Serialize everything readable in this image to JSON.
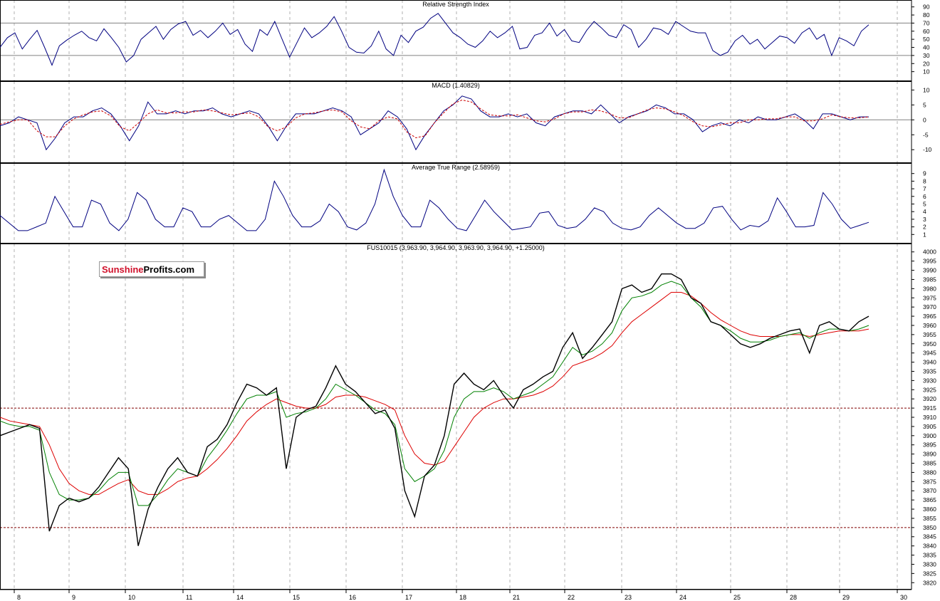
{
  "logo": {
    "part1": "Sunshine",
    "part2": "Profits.com"
  },
  "colors": {
    "rsi": "#000080",
    "macd": "#000080",
    "macd_signal": "#cc0000",
    "atr": "#000080",
    "price": "#000000",
    "ma_fast": "#008000",
    "ma_slow": "#dd0000",
    "guide": "#800000"
  },
  "chart_data": [
    {
      "type": "line",
      "title": "Relative Strength Index",
      "ylim": [
        0,
        95
      ],
      "yticks": [
        10,
        20,
        30,
        40,
        50,
        60,
        70,
        80,
        90
      ],
      "reference_lines": [
        30,
        70
      ],
      "series": [
        {
          "values": [
            40,
            52,
            58,
            38,
            50,
            61,
            40,
            18,
            42,
            49,
            55,
            60,
            52,
            48,
            63,
            52,
            40,
            22,
            30,
            50,
            58,
            66,
            50,
            62,
            69,
            72,
            55,
            61,
            52,
            60,
            70,
            56,
            62,
            44,
            35,
            62,
            55,
            72,
            50,
            28,
            46,
            64,
            52,
            58,
            66,
            78,
            60,
            40,
            34,
            33,
            42,
            60,
            38,
            30,
            55,
            46,
            60,
            65,
            76,
            82,
            70,
            58,
            52,
            44,
            40,
            48,
            60,
            52,
            58,
            66,
            38,
            40,
            55,
            58,
            70,
            54,
            62,
            48,
            46,
            61,
            72,
            64,
            55,
            52,
            68,
            62,
            40,
            50,
            64,
            62,
            56,
            72,
            66,
            60,
            58,
            58,
            36,
            30,
            34,
            48,
            55,
            44,
            50,
            38,
            46,
            54,
            52,
            45,
            58,
            64,
            50,
            56,
            30,
            52,
            48,
            42,
            60,
            68
          ]
        }
      ]
    },
    {
      "type": "line",
      "title": "MACD (1.40829)",
      "ylim": [
        -14,
        12
      ],
      "yticks": [
        10,
        5,
        0,
        -5,
        -10
      ],
      "reference_lines": [
        0
      ],
      "series": [
        {
          "values": [
            -2,
            -1,
            1,
            0,
            -1,
            -10,
            -6,
            -1,
            1,
            1,
            3,
            4,
            2,
            -2,
            -7,
            -2,
            6,
            2,
            2,
            3,
            2,
            3,
            3,
            4,
            2,
            1,
            2,
            3,
            2,
            -2,
            -7,
            -2,
            2,
            2,
            2,
            3,
            4,
            3,
            1,
            -5,
            -3,
            -1,
            3,
            1,
            -3,
            -10,
            -5,
            -1,
            3,
            5,
            8,
            7,
            3,
            1,
            1,
            2,
            1,
            2,
            -1,
            -2,
            1,
            2,
            3,
            3,
            2,
            5,
            2,
            -1,
            1,
            2,
            3,
            5,
            4,
            2,
            2,
            0,
            -4,
            -2,
            -1,
            -2,
            0,
            -1,
            1,
            0,
            0,
            1,
            2,
            0,
            -3,
            2,
            2,
            1,
            0,
            1,
            1
          ]
        }
      ]
    },
    {
      "type": "line",
      "title": "Average True Range (2.58959)",
      "ylim": [
        0,
        10
      ],
      "yticks": [
        1,
        2,
        3,
        4,
        5,
        6,
        7,
        8,
        9
      ],
      "series": [
        {
          "values": [
            3.5,
            2.5,
            1.5,
            1.5,
            2,
            2.5,
            6,
            4,
            2,
            2,
            5.5,
            5,
            2.5,
            1.5,
            3,
            6.5,
            5.5,
            3,
            2,
            2,
            4.5,
            4,
            2,
            2,
            3,
            3.5,
            2.5,
            1.5,
            1.5,
            3,
            8,
            6,
            3.5,
            2,
            2,
            2.8,
            5,
            4,
            2,
            1.6,
            2.5,
            5,
            9.5,
            6,
            3.5,
            2,
            2,
            5.5,
            4.5,
            3,
            1.8,
            1.5,
            3.5,
            5.5,
            4,
            2.8,
            1.6,
            1.8,
            2,
            3.8,
            4,
            2.2,
            1.8,
            2,
            3,
            4.5,
            4,
            2.5,
            1.8,
            1.6,
            2,
            3.5,
            4.5,
            3.5,
            2.5,
            1.8,
            1.8,
            2.5,
            4.5,
            4.7,
            3,
            1.6,
            2.2,
            2,
            2.8,
            5.8,
            4,
            2,
            2,
            2.2,
            6.5,
            5,
            3,
            1.8,
            2.2,
            2.6
          ]
        }
      ]
    },
    {
      "type": "line",
      "title": "FUS10015 (3,963.90, 3,964.90, 3,963.90, 3,964.90, +1.25000)",
      "x_categories": [
        "8",
        "9",
        "10",
        "11",
        "14",
        "15",
        "16",
        "17",
        "18",
        "21",
        "22",
        "23",
        "24",
        "25",
        "28",
        "29",
        "30"
      ],
      "ylim": [
        3817,
        4003
      ],
      "yticks": [
        3820,
        3825,
        3830,
        3835,
        3840,
        3845,
        3850,
        3855,
        3860,
        3865,
        3870,
        3875,
        3880,
        3885,
        3890,
        3895,
        3900,
        3905,
        3910,
        3915,
        3920,
        3925,
        3930,
        3935,
        3940,
        3945,
        3950,
        3955,
        3960,
        3965,
        3970,
        3975,
        3980,
        3985,
        3990,
        3995,
        4000
      ],
      "reference_lines": [
        3915,
        3850
      ],
      "series": [
        {
          "values": [
            3900,
            3902,
            3904,
            3906,
            3904,
            3848,
            3862,
            3866,
            3864,
            3866,
            3872,
            3880,
            3888,
            3882,
            3840,
            3860,
            3872,
            3882,
            3888,
            3880,
            3878,
            3894,
            3898,
            3906,
            3918,
            3928,
            3926,
            3922,
            3926,
            3882,
            3910,
            3914,
            3916,
            3926,
            3938,
            3928,
            3924,
            3918,
            3912,
            3914,
            3904,
            3870,
            3856,
            3878,
            3884,
            3900,
            3928,
            3934,
            3928,
            3925,
            3930,
            3922,
            3915,
            3925,
            3928,
            3932,
            3935,
            3948,
            3956,
            3942,
            3948,
            3955,
            3962,
            3980,
            3982,
            3978,
            3980,
            3988,
            3988,
            3985,
            3975,
            3972,
            3962,
            3960,
            3955,
            3950,
            3948,
            3950,
            3953,
            3955,
            3957,
            3958,
            3945,
            3960,
            3962,
            3958,
            3957,
            3962,
            3965
          ]
        },
        {
          "values": [
            3908,
            3906,
            3905,
            3905,
            3903,
            3880,
            3868,
            3865,
            3865,
            3866,
            3870,
            3876,
            3880,
            3880,
            3862,
            3862,
            3868,
            3876,
            3882,
            3880,
            3878,
            3888,
            3895,
            3903,
            3912,
            3920,
            3922,
            3922,
            3924,
            3910,
            3912,
            3913,
            3915,
            3920,
            3928,
            3925,
            3922,
            3918,
            3914,
            3912,
            3906,
            3882,
            3875,
            3878,
            3882,
            3892,
            3910,
            3920,
            3924,
            3924,
            3926,
            3924,
            3920,
            3922,
            3924,
            3928,
            3932,
            3940,
            3948,
            3944,
            3946,
            3950,
            3956,
            3968,
            3975,
            3976,
            3978,
            3982,
            3984,
            3982,
            3975,
            3970,
            3962,
            3960,
            3957,
            3953,
            3951,
            3951,
            3952,
            3954,
            3955,
            3956,
            3953,
            3956,
            3958,
            3958,
            3957,
            3958,
            3960
          ]
        },
        {
          "values": [
            3910,
            3908,
            3907,
            3906,
            3905,
            3895,
            3882,
            3874,
            3870,
            3868,
            3868,
            3871,
            3874,
            3876,
            3870,
            3868,
            3868,
            3871,
            3875,
            3877,
            3878,
            3882,
            3887,
            3893,
            3900,
            3908,
            3913,
            3917,
            3920,
            3918,
            3916,
            3915,
            3915,
            3917,
            3921,
            3922,
            3922,
            3921,
            3919,
            3917,
            3914,
            3900,
            3890,
            3885,
            3884,
            3886,
            3894,
            3902,
            3910,
            3915,
            3918,
            3920,
            3920,
            3921,
            3922,
            3924,
            3927,
            3932,
            3938,
            3940,
            3942,
            3945,
            3949,
            3956,
            3962,
            3966,
            3970,
            3974,
            3978,
            3978,
            3976,
            3972,
            3967,
            3963,
            3960,
            3957,
            3955,
            3954,
            3954,
            3954,
            3955,
            3955,
            3954,
            3955,
            3956,
            3957,
            3957,
            3957,
            3958
          ]
        }
      ]
    }
  ]
}
